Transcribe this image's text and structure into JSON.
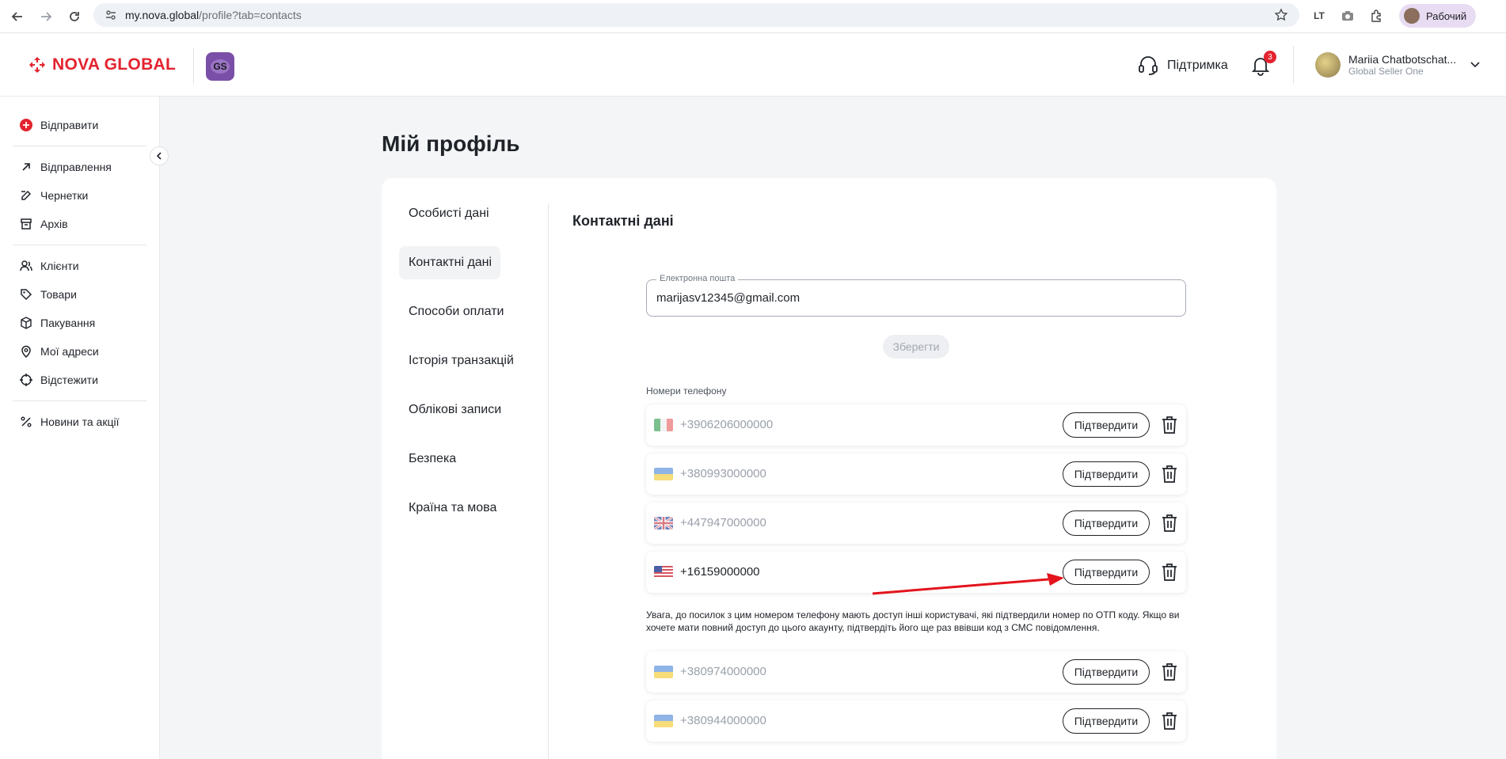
{
  "browser": {
    "url_host": "my.nova.global",
    "url_path": "/profile?tab=contacts",
    "profile_label": "Рабочий"
  },
  "header": {
    "brand": "NOVA GLOBAL",
    "badge": "GS",
    "support_label": "Підтримка",
    "notifications_count": "3",
    "user_name": "Mariia Chatbotschat...",
    "user_role": "Global Seller One"
  },
  "sidebar": {
    "send_label": "Відправити",
    "group1": [
      "Відправлення",
      "Чернетки",
      "Архів"
    ],
    "group2": [
      "Клієнти",
      "Товари",
      "Пакування",
      "Мої адреси",
      "Відстежити"
    ],
    "group3": [
      "Новини та акції"
    ]
  },
  "page": {
    "title": "Мій профіль"
  },
  "tabs": [
    "Особисті дані",
    "Контактні дані",
    "Способи оплати",
    "Історія транзакцій",
    "Облікові записи",
    "Безпека",
    "Країна та мова"
  ],
  "contacts": {
    "section_title": "Контактні дані",
    "email_label": "Електронна пошта",
    "email_value": "marijasv12345@gmail.com",
    "save_label": "Зберегти",
    "phones_label": "Номери телефону",
    "confirm_label": "Підтвердити",
    "phones": [
      {
        "flag": "it",
        "number": "+3906206000000"
      },
      {
        "flag": "ua",
        "number": "+380993000000"
      },
      {
        "flag": "gb",
        "number": "+447947000000"
      },
      {
        "flag": "us",
        "number": "+16159000000"
      },
      {
        "flag": "ua",
        "number": "+380974000000"
      },
      {
        "flag": "ua",
        "number": "+380944000000"
      }
    ],
    "warning": "Увага, до посилок з цим номером телефону мають доступ інші користувачі, які підтвердили номер по ОТП коду. Якщо ви хочете мати повний доступ до цього акаунту, підтвердіть його ще раз ввівши код з СМС повідомлення."
  },
  "colors": {
    "brand_red": "#e3232f",
    "badge_purple": "#7a4fa7",
    "annotation_arrow": "#e3141c"
  }
}
